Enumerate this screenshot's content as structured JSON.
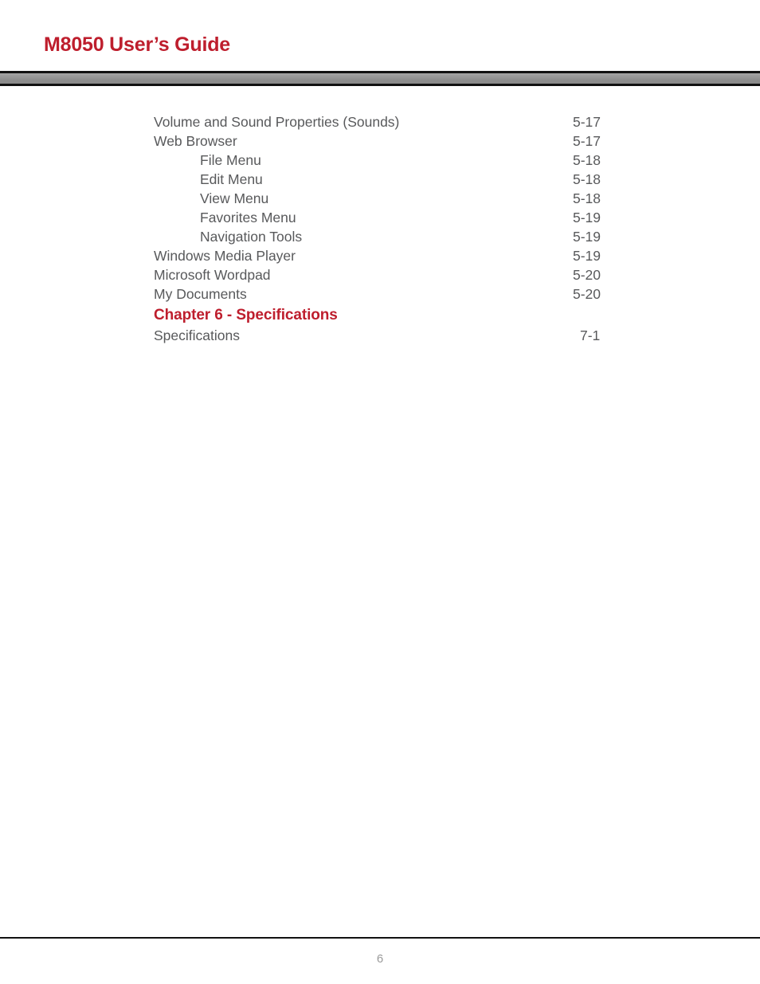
{
  "header": {
    "title": "M8050 User’s Guide",
    "accent_color": "#BE1E2D",
    "band_color": "#8e8e8e",
    "rule_color": "#111111"
  },
  "toc": {
    "text_color": "#58595B",
    "entries": [
      {
        "label": "Volume and Sound Properties (Sounds)",
        "page": "5-17",
        "level": 1,
        "kind": "entry"
      },
      {
        "label": "Web Browser",
        "page": "5-17",
        "level": 1,
        "kind": "entry"
      },
      {
        "label": "File Menu",
        "page": "5-18",
        "level": 2,
        "kind": "entry"
      },
      {
        "label": "Edit Menu",
        "page": "5-18",
        "level": 2,
        "kind": "entry"
      },
      {
        "label": "View Menu",
        "page": "5-18",
        "level": 2,
        "kind": "entry"
      },
      {
        "label": "Favorites Menu",
        "page": "5-19",
        "level": 2,
        "kind": "entry"
      },
      {
        "label": "Navigation Tools",
        "page": "5-19",
        "level": 2,
        "kind": "entry"
      },
      {
        "label": "Windows Media Player",
        "page": "5-19",
        "level": 1,
        "kind": "entry"
      },
      {
        "label": "Microsoft Wordpad",
        "page": "5-20",
        "level": 1,
        "kind": "entry"
      },
      {
        "label": "My Documents",
        "page": "5-20",
        "level": 1,
        "kind": "entry"
      },
      {
        "label": "Chapter 6 - Specifications",
        "page": "",
        "level": 1,
        "kind": "chapter"
      },
      {
        "label": "Specifications",
        "page": "7-1",
        "level": 1,
        "kind": "entry",
        "page_offset": true
      }
    ]
  },
  "footer": {
    "page_number": "6",
    "page_number_color": "#9a9a9a",
    "rule_color": "#111111"
  }
}
